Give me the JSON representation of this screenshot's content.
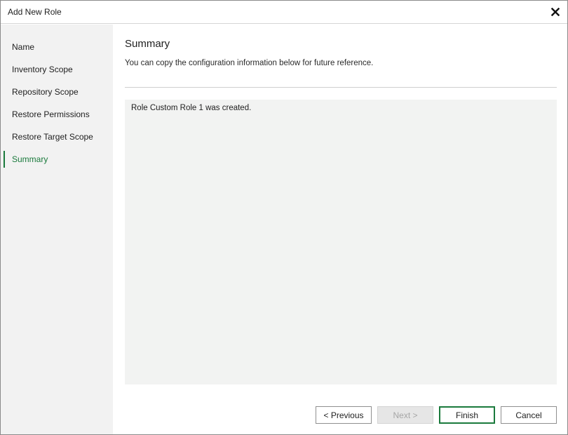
{
  "window": {
    "title": "Add New Role",
    "close_icon": "close-icon"
  },
  "sidebar": {
    "items": [
      {
        "label": "Name",
        "active": false
      },
      {
        "label": "Inventory Scope",
        "active": false
      },
      {
        "label": "Repository Scope",
        "active": false
      },
      {
        "label": "Restore Permissions",
        "active": false
      },
      {
        "label": "Restore Target Scope",
        "active": false
      },
      {
        "label": "Summary",
        "active": true
      }
    ]
  },
  "main": {
    "heading": "Summary",
    "description": "You can copy the configuration information below for future reference.",
    "summary_text": "Role Custom Role 1 was created."
  },
  "footer": {
    "previous_label": "< Previous",
    "next_label": "Next >",
    "finish_label": "Finish",
    "cancel_label": "Cancel"
  },
  "colors": {
    "accent": "#1a7a3c",
    "sidebar_bg": "#f2f2f2",
    "summary_bg": "#f2f3f2"
  }
}
